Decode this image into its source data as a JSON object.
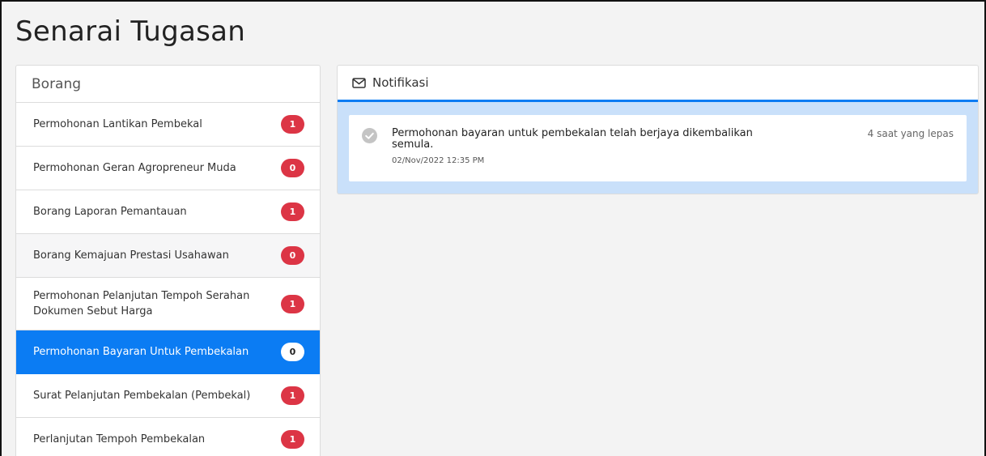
{
  "page": {
    "title": "Senarai Tugasan"
  },
  "forms": {
    "header": "Borang",
    "items": [
      {
        "label": "Permohonan Lantikan Pembekal",
        "count": "1"
      },
      {
        "label": "Permohonan Geran Agropreneur Muda",
        "count": "0"
      },
      {
        "label": "Borang Laporan Pemantauan",
        "count": "1"
      },
      {
        "label": "Borang Kemajuan Prestasi Usahawan",
        "count": "0"
      },
      {
        "label": "Permohonan Pelanjutan Tempoh Serahan Dokumen Sebut Harga",
        "count": "1"
      },
      {
        "label": "Permohonan Bayaran Untuk Pembekalan",
        "count": "0"
      },
      {
        "label": "Surat Pelanjutan Pembekalan (Pembekal)",
        "count": "1"
      },
      {
        "label": "Perlanjutan Tempoh Pembekalan",
        "count": "1"
      }
    ]
  },
  "notifications": {
    "header": "Notifikasi",
    "items": [
      {
        "message": "Permohonan bayaran untuk pembekalan telah berjaya dikembalikan semula.",
        "date": "02/Nov/2022 12:35 PM",
        "ago": "4 saat yang lepas"
      }
    ]
  },
  "colors": {
    "accent": "#0b7cf3",
    "badge": "#dc3545",
    "notif_bg": "#c9e0fa",
    "page_bg": "#f3f3f3"
  },
  "icons": {
    "notifications_header": "envelope-icon",
    "notification_status": "check-circle-icon"
  }
}
